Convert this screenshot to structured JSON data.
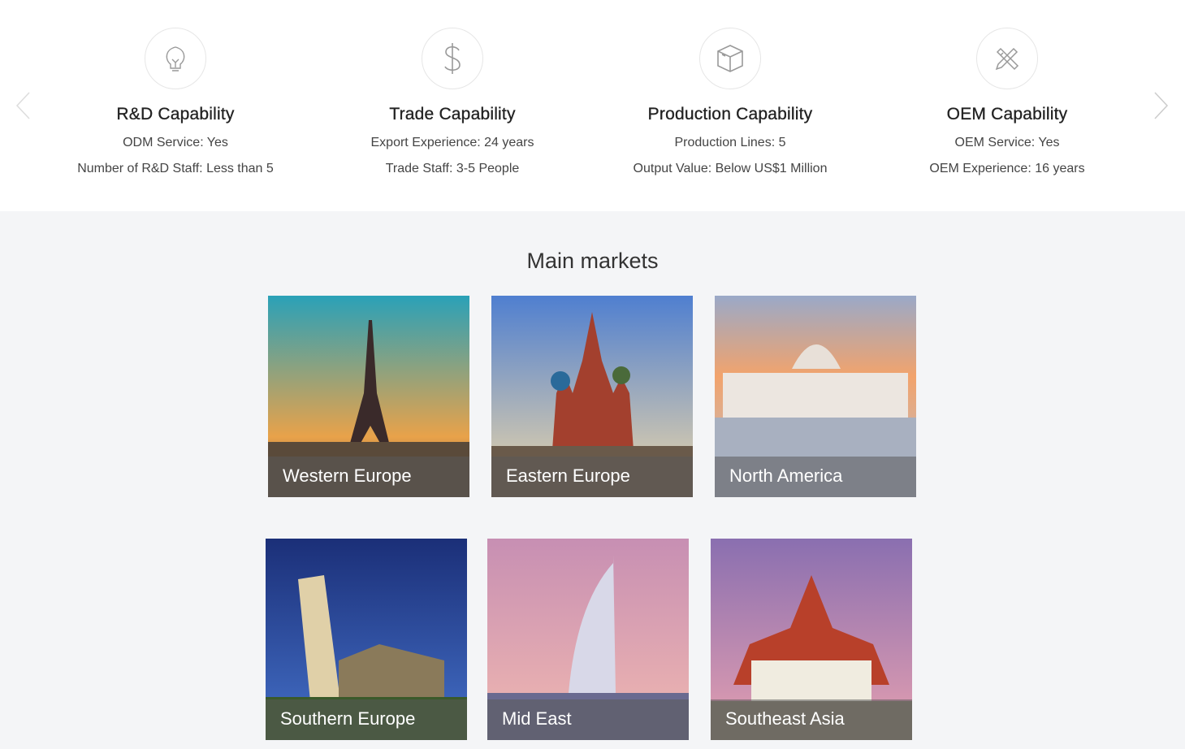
{
  "capabilities": [
    {
      "icon": "lightbulb-icon",
      "title": "R&D Capability",
      "lines": [
        "ODM Service:  Yes",
        "Number of R&D Staff:  Less than 5"
      ]
    },
    {
      "icon": "dollar-icon",
      "title": "Trade Capability",
      "lines": [
        "Export Experience:  24 years",
        "Trade Staff:  3-5 People"
      ]
    },
    {
      "icon": "box-icon",
      "title": "Production Capability",
      "lines": [
        "Production Lines:  5",
        "Output Value:  Below US$1 Million"
      ]
    },
    {
      "icon": "pencil-ruler-icon",
      "title": "OEM Capability",
      "lines": [
        "OEM Service:  Yes",
        "OEM Experience:  16 years"
      ]
    }
  ],
  "markets_title": "Main markets",
  "markets": [
    {
      "label": "Western Europe",
      "sky": [
        "#2aa1b8",
        "#e8a24a"
      ]
    },
    {
      "label": "Eastern Europe",
      "sky": [
        "#4f7fd0",
        "#f0d9a8"
      ]
    },
    {
      "label": "North America",
      "sky": [
        "#9aa9c8",
        "#f2a36c"
      ]
    },
    {
      "label": "Southern Europe",
      "sky": [
        "#1b2f78",
        "#4470c8"
      ]
    },
    {
      "label": "Mid East",
      "sky": [
        "#c78fb3",
        "#f1b8b0"
      ]
    },
    {
      "label": "Southeast Asia",
      "sky": [
        "#8a6fb0",
        "#e6a0b0"
      ]
    }
  ]
}
